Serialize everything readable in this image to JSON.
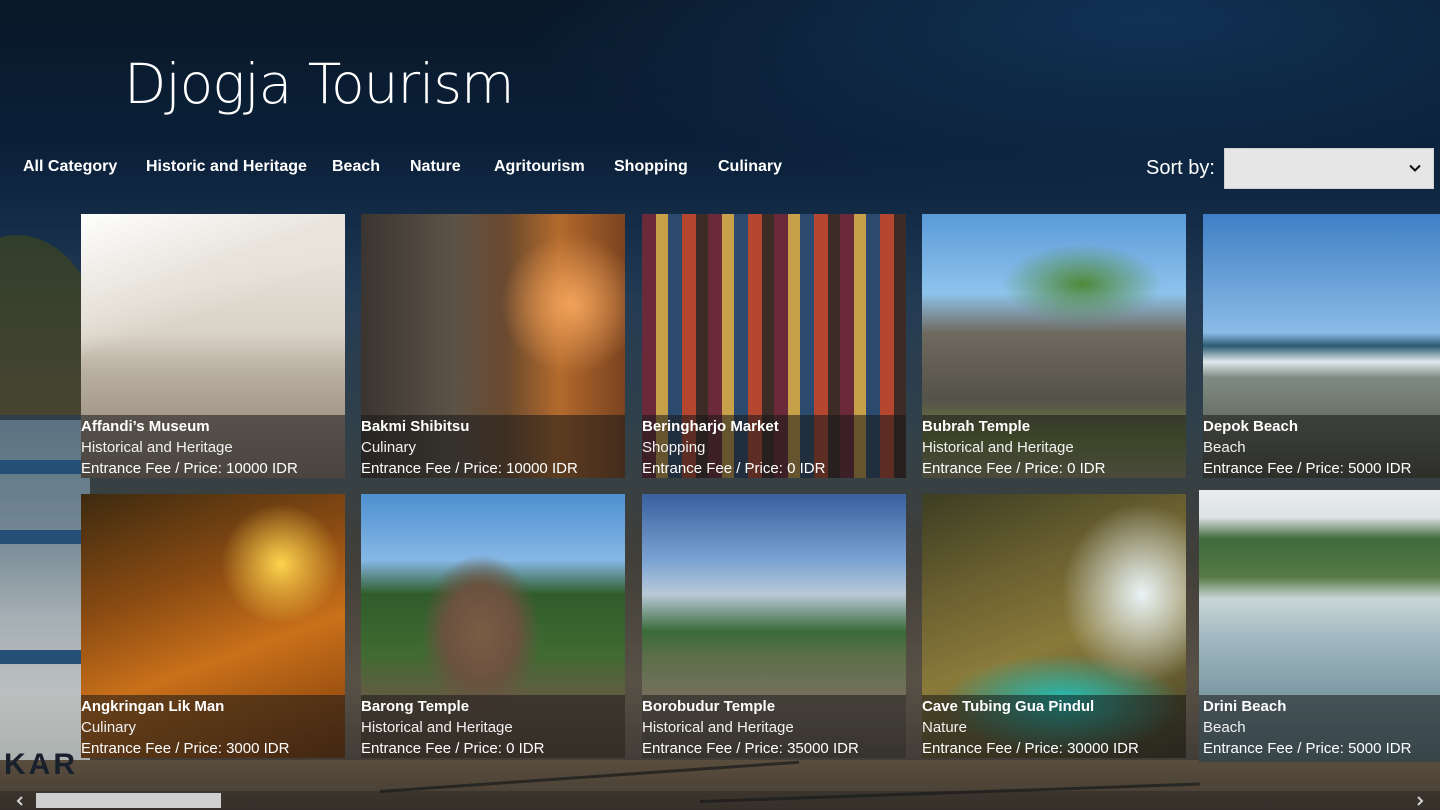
{
  "app": {
    "title": "Djogja Tourism"
  },
  "categories": [
    {
      "label": "All Category"
    },
    {
      "label": "Historic and Heritage"
    },
    {
      "label": "Beach"
    },
    {
      "label": "Nature"
    },
    {
      "label": "Agritourism"
    },
    {
      "label": "Shopping"
    },
    {
      "label": "Culinary"
    }
  ],
  "sort": {
    "label": "Sort by:",
    "selected": ""
  },
  "places": [
    {
      "name": "Affandi’s Museum",
      "category": "Historical and Heritage",
      "price": "Entrance Fee / Price: 10000 IDR"
    },
    {
      "name": "Bakmi Shibitsu",
      "category": "Culinary",
      "price": "Entrance Fee / Price: 10000 IDR"
    },
    {
      "name": "Beringharjo Market",
      "category": "Shopping",
      "price": "Entrance Fee / Price: 0 IDR"
    },
    {
      "name": "Bubrah Temple",
      "category": "Historical and Heritage",
      "price": "Entrance Fee / Price: 0 IDR"
    },
    {
      "name": "Depok Beach",
      "category": "Beach",
      "price": "Entrance Fee / Price: 5000 IDR"
    },
    {
      "name": "Angkringan Lik Man",
      "category": "Culinary",
      "price": "Entrance Fee / Price: 3000 IDR"
    },
    {
      "name": "Barong Temple",
      "category": "Historical and Heritage",
      "price": "Entrance Fee / Price: 0 IDR"
    },
    {
      "name": "Borobudur Temple",
      "category": "Historical and Heritage",
      "price": "Entrance Fee / Price: 35000 IDR"
    },
    {
      "name": "Cave Tubing Gua Pindul",
      "category": "Nature",
      "price": "Entrance Fee / Price: 30000 IDR"
    },
    {
      "name": "Drini Beach",
      "category": "Beach",
      "price": "Entrance Fee / Price: 5000 IDR"
    }
  ],
  "background_text": "KAR",
  "colors": {
    "caption_overlay": "#191919",
    "sort_box": "#e6e6e6",
    "scroll_thumb": "#cfcfcf"
  },
  "icons": {
    "sort_dropdown": "chevron-down-icon",
    "scroll_left": "arrow-left-icon",
    "scroll_right": "arrow-right-icon"
  }
}
